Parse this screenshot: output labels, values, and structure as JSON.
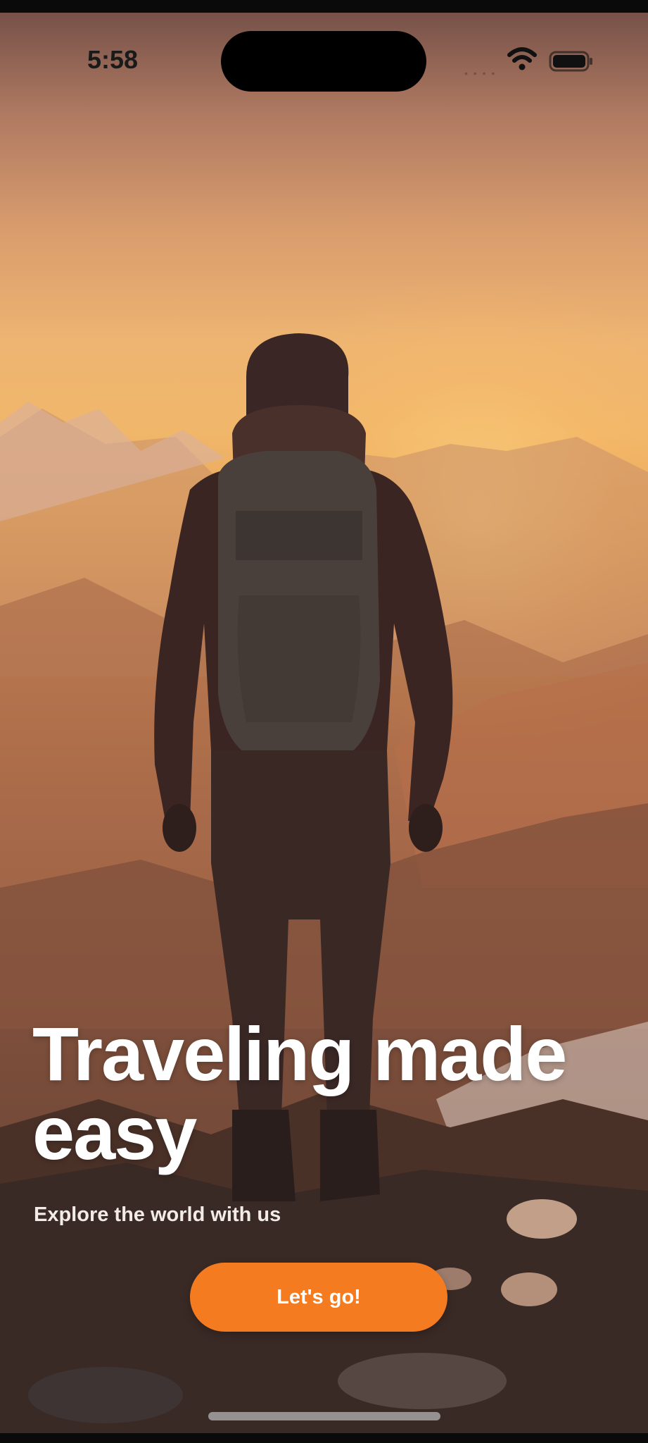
{
  "status_bar": {
    "time": "5:58",
    "icons": [
      "wifi-icon",
      "battery-icon"
    ]
  },
  "hero": {
    "headline": "Traveling made easy",
    "subtitle": "Explore the world with us",
    "cta_label": "Let's go!"
  },
  "colors": {
    "accent": "#F47B20",
    "headline_text": "#FFFFFF"
  }
}
